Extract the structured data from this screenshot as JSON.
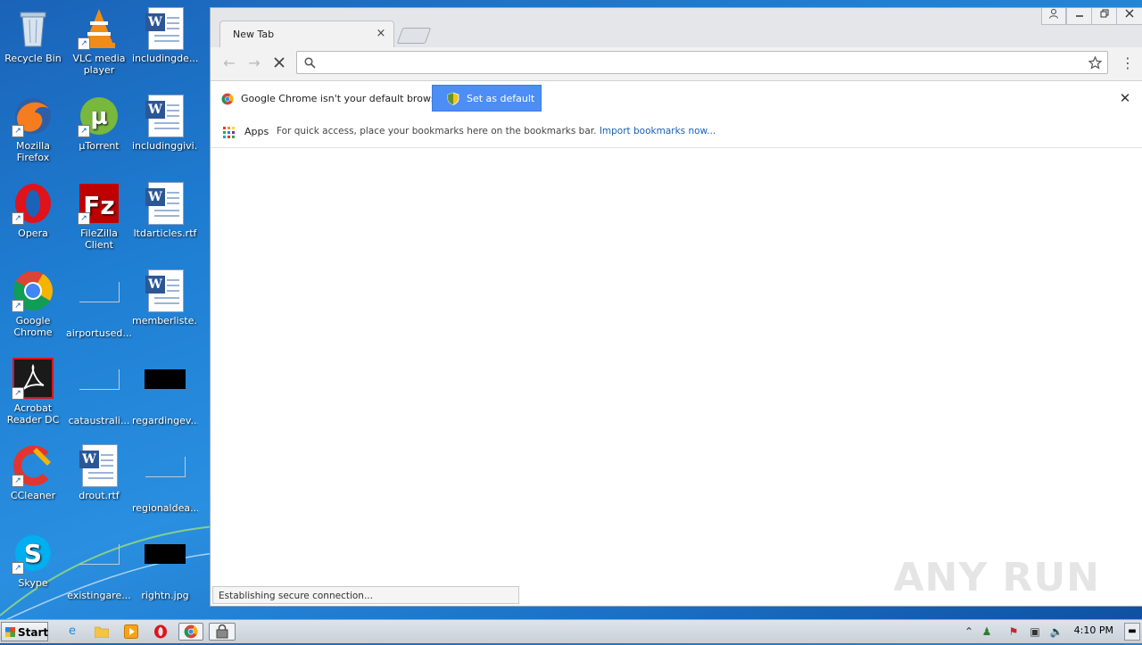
{
  "desktop": {
    "icons": [
      {
        "label": "Recycle Bin",
        "icon": "recycle-bin-icon"
      },
      {
        "label": "VLC media player",
        "icon": "vlc-icon"
      },
      {
        "label": "includingde....",
        "icon": "word-document-icon"
      },
      {
        "label": "Mozilla Firefox",
        "icon": "firefox-icon"
      },
      {
        "label": "µTorrent",
        "icon": "utorrent-icon"
      },
      {
        "label": "includinggivi...",
        "icon": "word-document-icon"
      },
      {
        "label": "Opera",
        "icon": "opera-icon"
      },
      {
        "label": "FileZilla Client",
        "icon": "filezilla-icon"
      },
      {
        "label": "ltdarticles.rtf",
        "icon": "word-document-icon"
      },
      {
        "label": "Google Chrome",
        "icon": "chrome-icon"
      },
      {
        "label": "airportused....",
        "icon": "blank-file-icon"
      },
      {
        "label": "memberliste....",
        "icon": "word-document-icon"
      },
      {
        "label": "Acrobat Reader DC",
        "icon": "acrobat-icon"
      },
      {
        "label": "cataustrali...",
        "icon": "blank-file-icon"
      },
      {
        "label": "regardingev...",
        "icon": "image-file-icon"
      },
      {
        "label": "CCleaner",
        "icon": "ccleaner-icon"
      },
      {
        "label": "drout.rtf",
        "icon": "word-document-icon"
      },
      {
        "label": "regionaldea...",
        "icon": "blank-file-icon"
      },
      {
        "label": "Skype",
        "icon": "skype-icon"
      },
      {
        "label": "existingare...",
        "icon": "blank-file-icon"
      },
      {
        "label": "rightn.jpg",
        "icon": "image-file-icon"
      }
    ]
  },
  "browser": {
    "tab_title": "New Tab",
    "tab_close": "×",
    "omnibox_value": "",
    "infobar_text": "Google Chrome isn't your default browser.",
    "set_default_label": "Set as default",
    "infobar_close": "✕",
    "apps_label": "Apps",
    "bookmarks_hint": "For quick access, place your bookmarks here on the bookmarks bar.",
    "import_link": "Import bookmarks now...",
    "status": "Establishing secure connection...",
    "watermark": "ANY RUN"
  },
  "taskbar": {
    "start_label": "Start",
    "clock": "4:10 PM"
  },
  "colors": {
    "accent": "#4c8ef5",
    "desktop_blue": "#1f7fd3"
  }
}
